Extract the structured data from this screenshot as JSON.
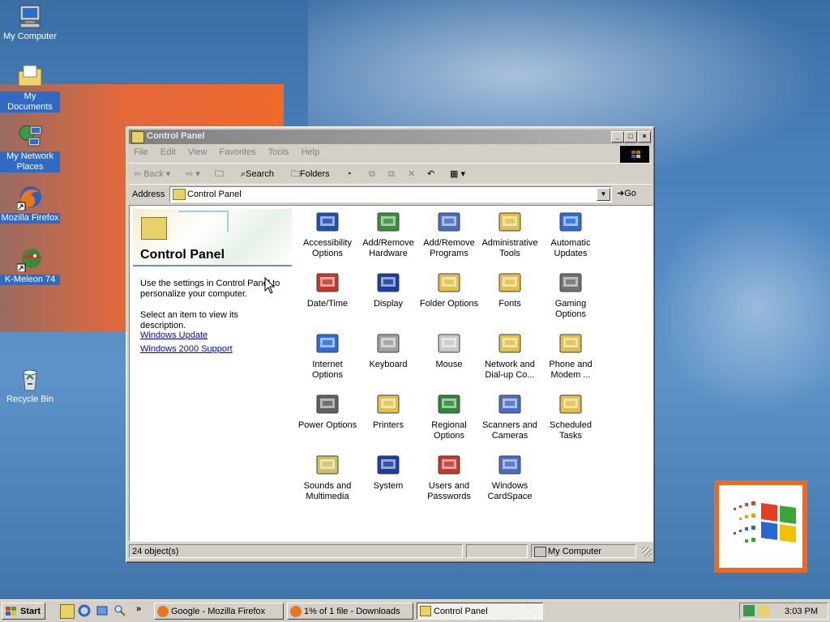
{
  "desktop": {
    "icons": [
      {
        "label": "My Computer",
        "icon": "computer-icon"
      },
      {
        "label": "My Documents",
        "icon": "documents-folder-icon"
      },
      {
        "label": "My Network Places",
        "icon": "network-places-icon"
      },
      {
        "label": "Mozilla Firefox",
        "icon": "firefox-icon"
      },
      {
        "label": "K-Meleon 74",
        "icon": "kmeleon-icon"
      },
      {
        "label": "Recycle Bin",
        "icon": "recycle-bin-icon"
      }
    ]
  },
  "window": {
    "title": "Control Panel",
    "buttons": {
      "minimize": "_",
      "maximize": "□",
      "close": "×"
    },
    "menu": [
      "File",
      "Edit",
      "View",
      "Favorites",
      "Tools",
      "Help"
    ],
    "toolbar": {
      "back": "Back",
      "search": "Search",
      "folders": "Folders"
    },
    "address": {
      "label": "Address",
      "value": "Control Panel",
      "go": "Go"
    },
    "left_pane": {
      "title": "Control Panel",
      "description": "Use the settings in Control Panel to personalize your computer.",
      "hint": "Select an item to view its description.",
      "links": [
        "Windows Update",
        "Windows 2000 Support"
      ]
    },
    "items": [
      {
        "label": "Accessibility Options",
        "icon": "accessibility-icon",
        "color": "#1f4fb0"
      },
      {
        "label": "Add/Remove Hardware",
        "icon": "add-hardware-icon",
        "color": "#3c8d3c"
      },
      {
        "label": "Add/Remove Programs",
        "icon": "add-programs-icon",
        "color": "#4a6cc2"
      },
      {
        "label": "Administrative Tools",
        "icon": "admin-tools-icon",
        "color": "#e0c04a"
      },
      {
        "label": "Automatic Updates",
        "icon": "windows-update-icon",
        "color": "#2b6fd6"
      },
      {
        "label": "Date/Time",
        "icon": "date-time-icon",
        "color": "#c0392b"
      },
      {
        "label": "Display",
        "icon": "display-icon",
        "color": "#1b3d9c"
      },
      {
        "label": "Folder Options",
        "icon": "folder-options-icon",
        "color": "#e0c04a"
      },
      {
        "label": "Fonts",
        "icon": "fonts-icon",
        "color": "#e0c04a"
      },
      {
        "label": "Gaming Options",
        "icon": "joystick-icon",
        "color": "#707070"
      },
      {
        "label": "Internet Options",
        "icon": "internet-options-icon",
        "color": "#2b6fd6"
      },
      {
        "label": "Keyboard",
        "icon": "keyboard-icon",
        "color": "#a0a0a0"
      },
      {
        "label": "Mouse",
        "icon": "mouse-icon",
        "color": "#c8c8c8"
      },
      {
        "label": "Network and Dial-up Co...",
        "icon": "network-dialup-icon",
        "color": "#e0c04a"
      },
      {
        "label": "Phone and Modem ...",
        "icon": "phone-modem-icon",
        "color": "#e0c04a"
      },
      {
        "label": "Power Options",
        "icon": "power-options-icon",
        "color": "#606060"
      },
      {
        "label": "Printers",
        "icon": "printers-icon",
        "color": "#e0c04a"
      },
      {
        "label": "Regional Options",
        "icon": "globe-icon",
        "color": "#2a8a3a"
      },
      {
        "label": "Scanners and Cameras",
        "icon": "scanner-icon",
        "color": "#4a6cc2"
      },
      {
        "label": "Scheduled Tasks",
        "icon": "scheduled-tasks-icon",
        "color": "#e0c04a"
      },
      {
        "label": "Sounds and Multimedia",
        "icon": "speaker-icon",
        "color": "#d0c060"
      },
      {
        "label": "System",
        "icon": "system-computer-icon",
        "color": "#1b3d9c"
      },
      {
        "label": "Users and Passwords",
        "icon": "users-icon",
        "color": "#c0392b"
      },
      {
        "label": "Windows CardSpace",
        "icon": "cardspace-icon",
        "color": "#4a6cc2"
      }
    ],
    "status": {
      "count": "24 object(s)",
      "zone": "My Computer"
    }
  },
  "taskbar": {
    "start": "Start",
    "tasks": [
      {
        "label": "Google - Mozilla Firefox",
        "active": false
      },
      {
        "label": "1% of 1 file - Downloads",
        "active": false
      },
      {
        "label": "Control Panel",
        "active": true
      }
    ],
    "clock": "3:03 PM",
    "quicklaunch_more": "»"
  }
}
